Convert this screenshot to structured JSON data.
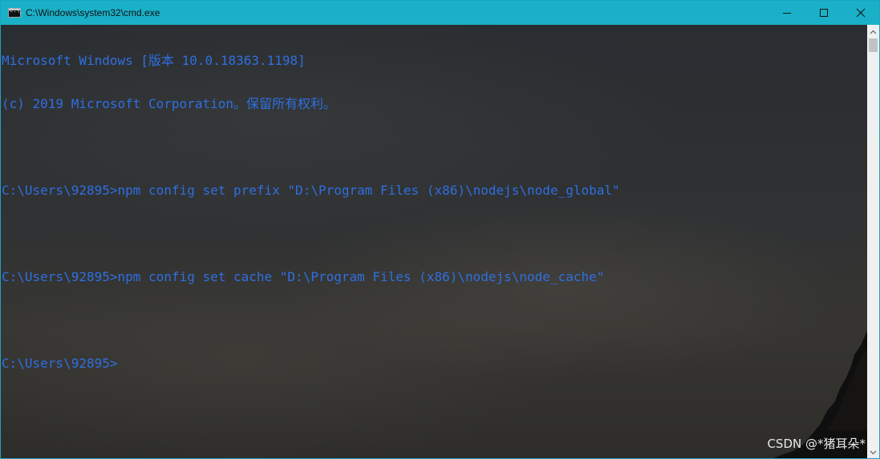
{
  "window": {
    "title": "C:\\Windows\\system32\\cmd.exe",
    "controls": {
      "minimize": "minimize",
      "maximize": "maximize",
      "close": "close"
    }
  },
  "console": {
    "header_line_1": "Microsoft Windows [版本 10.0.18363.1198]",
    "header_line_2": "(c) 2019 Microsoft Corporation。保留所有权利。",
    "blank": "",
    "entries": [
      {
        "prompt": "C:\\Users\\92895>",
        "command": "npm config set prefix \"D:\\Program Files (x86)\\nodejs\\node_global\""
      },
      {
        "prompt": "C:\\Users\\92895>",
        "command": "npm config set cache \"D:\\Program Files (x86)\\nodejs\\node_cache\""
      },
      {
        "prompt": "C:\\Users\\92895>",
        "command": ""
      }
    ]
  },
  "watermark": "CSDN @*猪耳朵*",
  "icons": {
    "app": "cmd-console-icon",
    "minimize": "minimize-icon",
    "maximize": "maximize-icon",
    "close": "close-icon",
    "scroll_up": "scroll-up-arrow-icon",
    "scroll_down": "scroll-down-arrow-icon"
  },
  "colors": {
    "titlebar": "#1ab0c8",
    "console_text": "#2f6fe0",
    "scrollbar": "#f0f0f0"
  }
}
